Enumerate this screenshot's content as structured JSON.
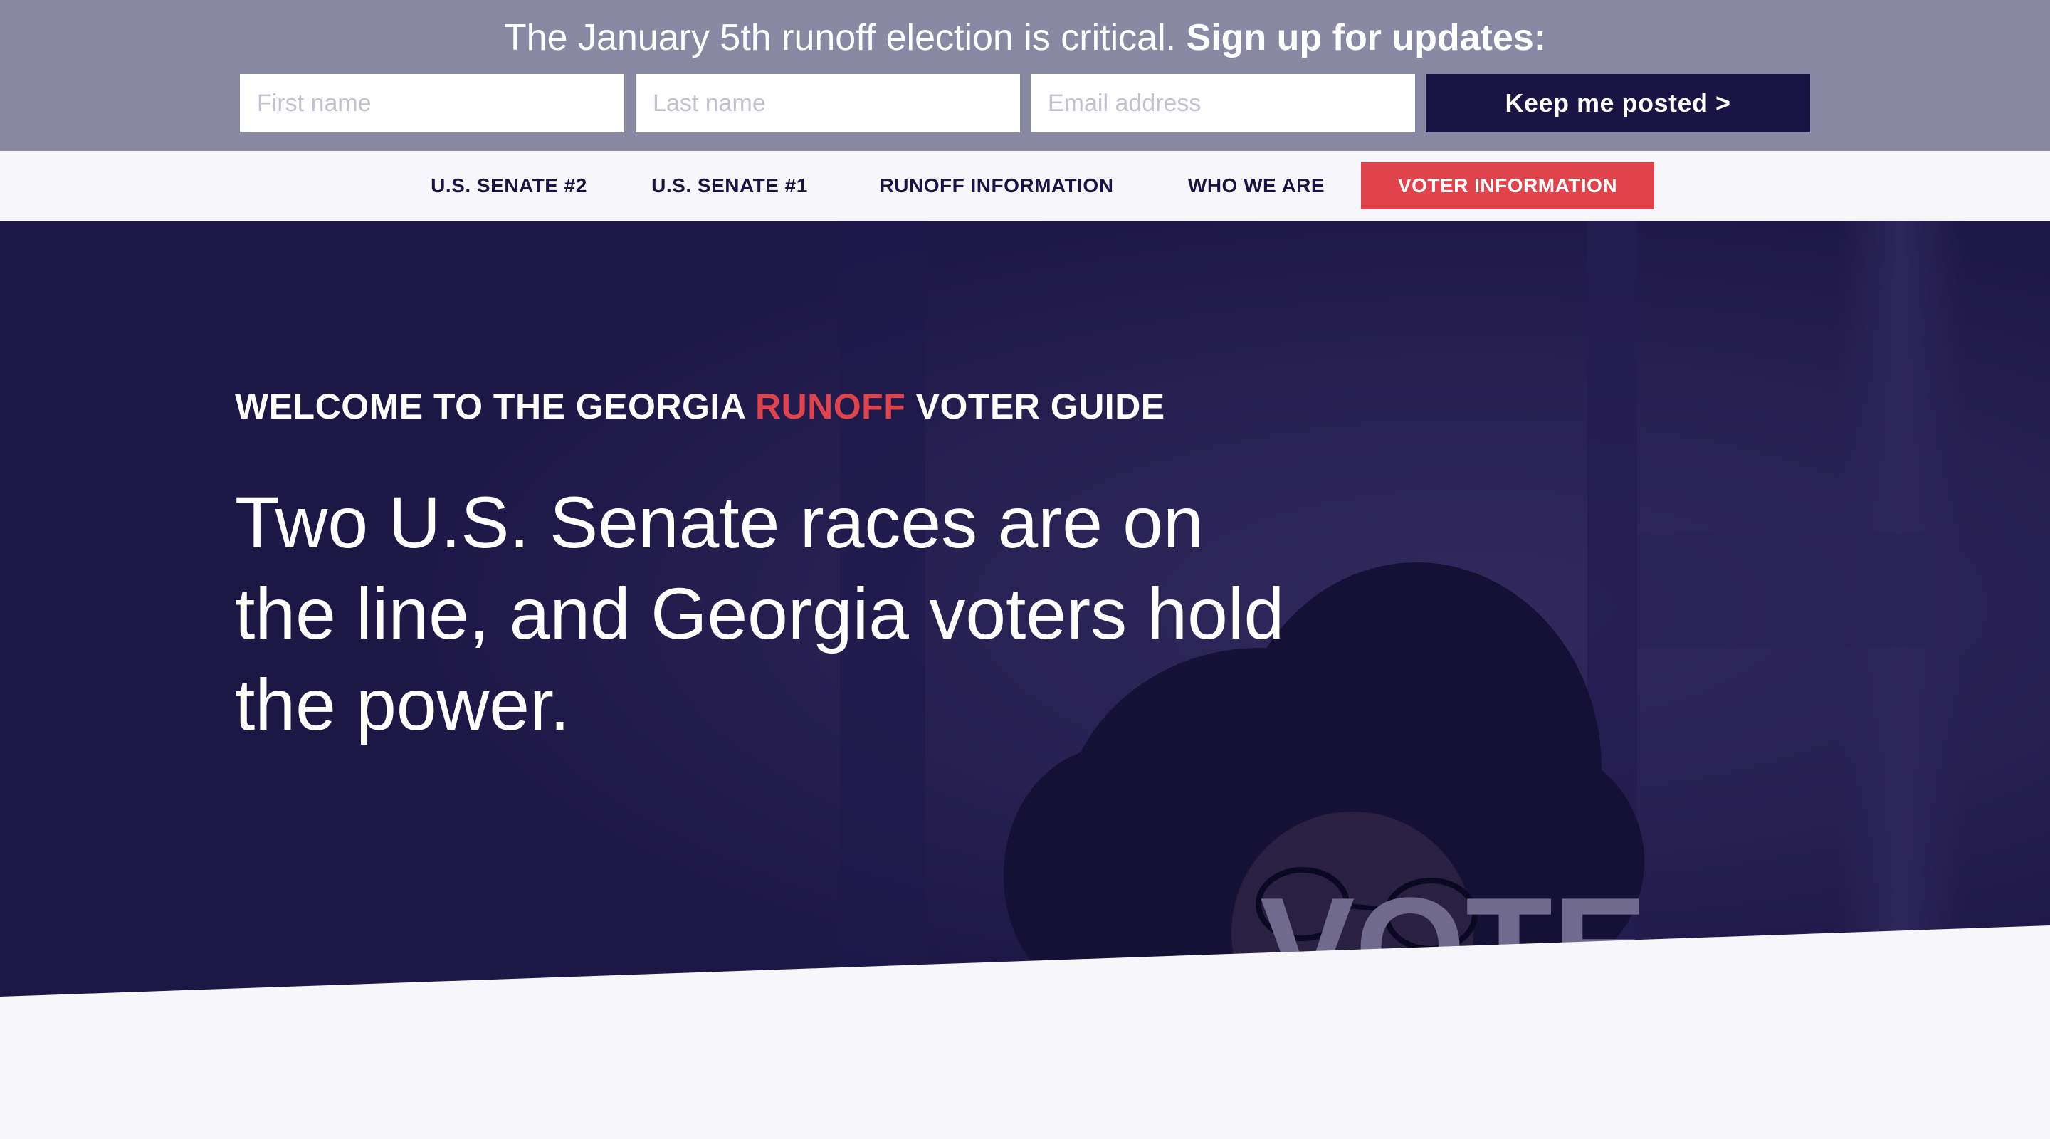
{
  "signup": {
    "lead_text": "The January 5th runoff election is critical.",
    "cta_text": "Sign up for updates:",
    "first_name_placeholder": "First name",
    "last_name_placeholder": "Last name",
    "email_placeholder": "Email address",
    "submit_label": "Keep me posted >"
  },
  "nav": {
    "items": [
      {
        "label": "U.S. SENATE #2"
      },
      {
        "label": "U.S. SENATE #1"
      },
      {
        "label": "RUNOFF INFORMATION"
      },
      {
        "label": "WHO WE ARE"
      },
      {
        "label": "VOTER INFORMATION"
      }
    ]
  },
  "hero": {
    "eyebrow_before": "WELCOME TO THE GEORGIA ",
    "eyebrow_highlight": "RUNOFF",
    "eyebrow_after": " VOTER GUIDE",
    "headline": "Two U.S. Senate races are on the line, and Georgia voters hold the power.",
    "mask_text": "VOTE"
  },
  "colors": {
    "banner": "#8a89a4",
    "navy": "#1a1444",
    "hero_overlay": "#1d1746",
    "accent_red": "#e0434b",
    "page_bg": "#f7f7fb"
  }
}
